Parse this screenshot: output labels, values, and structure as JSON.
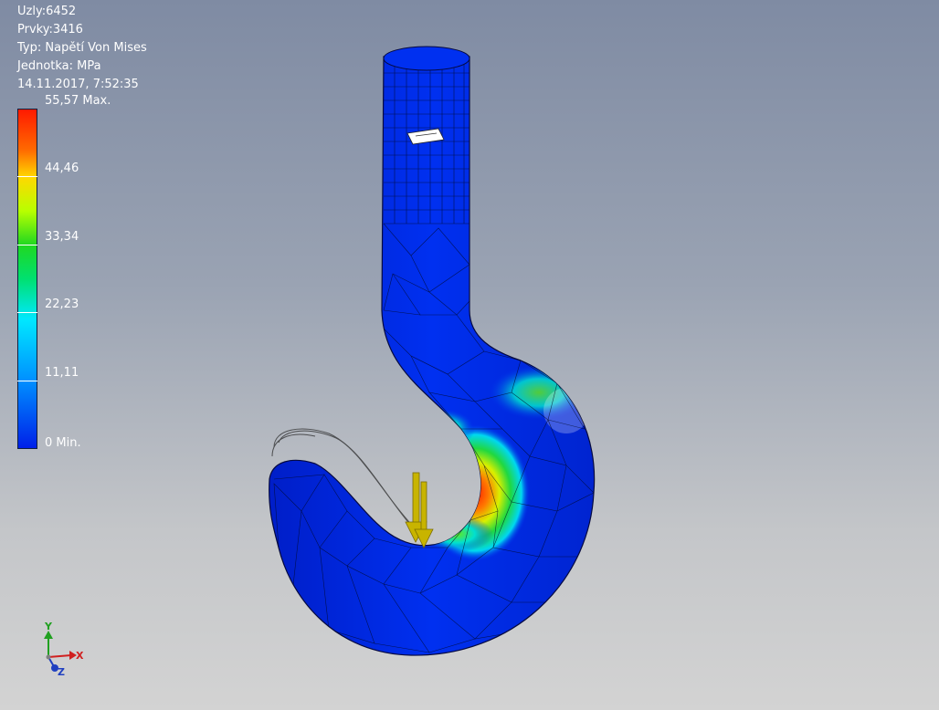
{
  "info": {
    "nodes": "Uzly:6452",
    "elements": "Prvky:3416",
    "type": "Typ: Napětí Von Mises",
    "unit": "Jednotka: MPa",
    "timestamp": "14.11.2017, 7:52:35"
  },
  "legend": {
    "labels": [
      "55,57 Max.",
      "44,46",
      "33,34",
      "22,23",
      "11,11",
      "0 Min."
    ],
    "max": 55.57,
    "min": 0
  },
  "triad": {
    "x": "X",
    "y": "Y",
    "z": "Z"
  },
  "colors": {
    "background_top": "#7f8ba3",
    "background_bottom": "#d3d3d3",
    "low_stress": "#0020e8",
    "high_stress": "#ff1a00",
    "load_arrow": "#c8b400"
  }
}
